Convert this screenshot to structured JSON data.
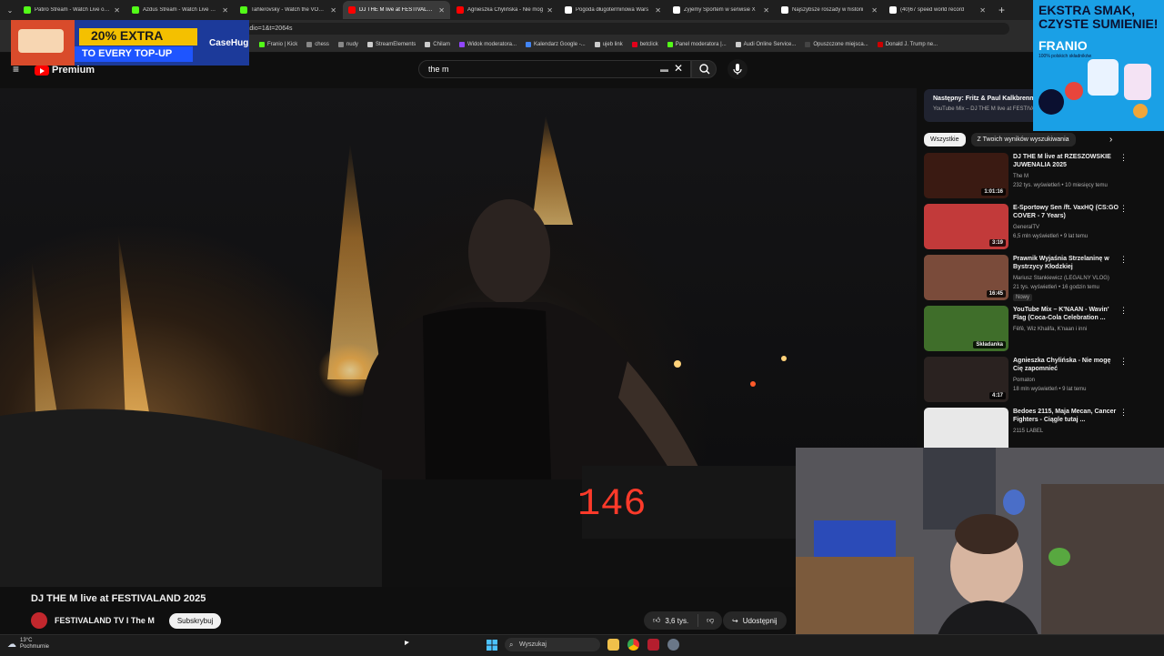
{
  "tabs": [
    {
      "title": "Patiro Stream - Watch Live on K",
      "color": "#53fc18"
    },
    {
      "title": "Azdus Stream - Watch Live on K",
      "color": "#53fc18"
    },
    {
      "title": "Tahlerovsky - Watch the VOD o",
      "color": "#53fc18"
    },
    {
      "title": "DJ THE M live at FESTIVALAND",
      "color": "#ff0000",
      "active": true
    },
    {
      "title": "Agnieszka Chylińska - Nie mog",
      "color": "#ff0000"
    },
    {
      "title": "Pogoda długoterminowa Wars",
      "color": "#ffffff"
    },
    {
      "title": "Żyjemy Sportem w serwisie X",
      "color": "#ffffff"
    },
    {
      "title": "Najszybsze roszady w historii",
      "color": "#ffffff"
    },
    {
      "title": "(40)67 speed world record",
      "color": "#ffffff"
    }
  ],
  "address": {
    "url_fragment": "rt_radio=1&t=2064s"
  },
  "bookmarks": [
    {
      "label": "Franio | Kick",
      "color": "#53fc18"
    },
    {
      "label": "chess",
      "color": "#888888"
    },
    {
      "label": "nudy",
      "color": "#888888"
    },
    {
      "label": "StreamElements",
      "color": "#cccccc"
    },
    {
      "label": "Chilam",
      "color": "#cccccc"
    },
    {
      "label": "Widok moderatora...",
      "color": "#9146ff"
    },
    {
      "label": "Kalendarz Google -...",
      "color": "#4285f4"
    },
    {
      "label": "ujeb link",
      "color": "#cccccc"
    },
    {
      "label": "betclick",
      "color": "#e3001b"
    },
    {
      "label": "Panel moderatora |...",
      "color": "#53fc18"
    },
    {
      "label": "Audi Online Service...",
      "color": "#cccccc"
    },
    {
      "label": "Opuszczone miejsca...",
      "color": "#444444"
    },
    {
      "label": "Donald J. Trump ne...",
      "color": "#cc0000"
    }
  ],
  "header": {
    "logo_text": "Premium",
    "search_value": "the m"
  },
  "video": {
    "title": "DJ THE M live at FESTIVALAND 2025",
    "channel": "FESTIVALAND TV I The M",
    "subscribe_label": "Subskrybuj",
    "likes": "3,6 tys.",
    "share_label": "Udostępnij",
    "display_digits": "146"
  },
  "sidebar": {
    "next_label": "Następny: Fritz & Paul Kalkbrenner",
    "next_sub": "YouTube Mix – DJ THE M live at FESTIVALAND",
    "chips": [
      "Wszystkie",
      "Z Twoich wyników wyszukiwania"
    ],
    "recommendations": [
      {
        "title": "DJ THE M live at RZESZOWSKIE JUWENALIA 2025",
        "channel": "The M",
        "meta": "232 tys. wyświetleń • 10 miesięcy temu",
        "duration": "1:01:16",
        "thumb": "#3a1a12"
      },
      {
        "title": "E-Sportowy Sen /ft. VaxHQ (CS:GO COVER - 7 Years)",
        "channel": "GeneralTV",
        "meta": "6,5 mln wyświetleń • 9 lat temu",
        "duration": "3:19",
        "thumb": "#c23a3a"
      },
      {
        "title": "Prawnik Wyjaśnia Strzelaninę w Bystrzycy Kłodzkiej",
        "channel": "Mariusz Stankiewicz (LEGALNY VLOG)",
        "meta": "21 tys. wyświetleń • 16 godzin temu",
        "badge": "Nowy",
        "duration": "16:45",
        "thumb": "#7a4b3a"
      },
      {
        "title": "YouTube Mix – K'NAAN - Wavin' Flag (Coca-Cola Celebration ...",
        "channel": "Fêfê, Wiz Khalifa, K'naan i inni",
        "meta": "",
        "duration": "Składanka",
        "thumb": "#3f6e2a"
      },
      {
        "title": "Agnieszka Chylińska - Nie mogę Cię zapomnieć",
        "channel": "Pomaton",
        "meta": "18 mln wyświetleń • 9 lat temu",
        "duration": "4:17",
        "thumb": "#2a2220"
      },
      {
        "title": "Bedoes 2115, Maja Mecan, Cancer Fighters - Ciągle tutaj ...",
        "channel": "2115 LABEL",
        "meta": "",
        "duration": "",
        "thumb": "#e8e8e8"
      }
    ]
  },
  "promo_left": {
    "line1": "20% EXTRA",
    "line2": "TO EVERY TOP-UP",
    "brand": "CaseHug"
  },
  "promo_right": {
    "line1": "EKSTRA SMAK,",
    "line2": "CZYSTE SUMIENIE!",
    "brand": "FRANIO",
    "sub": "100% polskich składników"
  },
  "taskbar": {
    "temperature": "13°C",
    "weather": "Pochmurnie",
    "search_placeholder": "Wyszukaj"
  },
  "colors": {
    "accent": "#ff0000",
    "background": "#0f0f0f"
  }
}
